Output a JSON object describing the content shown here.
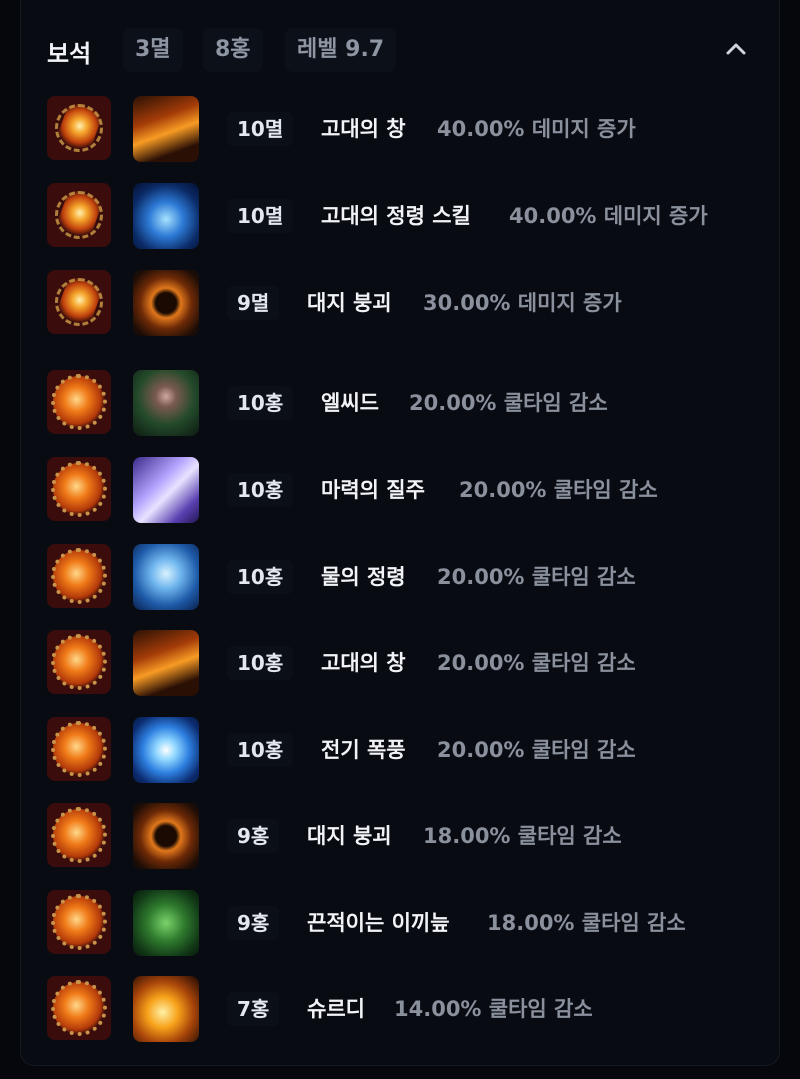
{
  "header": {
    "title": "보석",
    "chips": [
      "3멸",
      "8홍",
      "레벨 9.7"
    ]
  },
  "gems": [
    {
      "gem_type": "ruby",
      "skill_icon": "ancient-spear-icon",
      "level": "10멸",
      "name": "고대의 창",
      "effect": "40.00% 데미지 증가"
    },
    {
      "gem_type": "ruby",
      "skill_icon": "ancient-spirit-skill-icon",
      "level": "10멸",
      "name": "고대의 정령 스킬",
      "effect": "40.00% 데미지 증가"
    },
    {
      "gem_type": "ruby",
      "skill_icon": "earth-collapse-icon",
      "level": "9멸",
      "name": "대지 붕괴",
      "effect": "30.00% 데미지 증가"
    },
    {
      "gem_type": "sapphire",
      "skill_icon": "elcid-icon",
      "level": "10홍",
      "name": "엘씨드",
      "effect": "20.00% 쿨타임 감소"
    },
    {
      "gem_type": "sapphire",
      "skill_icon": "mana-rush-icon",
      "level": "10홍",
      "name": "마력의 질주",
      "effect": "20.00% 쿨타임 감소"
    },
    {
      "gem_type": "sapphire",
      "skill_icon": "water-spirit-icon",
      "level": "10홍",
      "name": "물의 정령",
      "effect": "20.00% 쿨타임 감소"
    },
    {
      "gem_type": "sapphire",
      "skill_icon": "ancient-spear-icon",
      "level": "10홍",
      "name": "고대의 창",
      "effect": "20.00% 쿨타임 감소"
    },
    {
      "gem_type": "sapphire",
      "skill_icon": "electric-storm-icon",
      "level": "10홍",
      "name": "전기 폭풍",
      "effect": "20.00% 쿨타임 감소"
    },
    {
      "gem_type": "sapphire",
      "skill_icon": "earth-collapse-icon",
      "level": "9홍",
      "name": "대지 붕괴",
      "effect": "18.00% 쿨타임 감소"
    },
    {
      "gem_type": "sapphire",
      "skill_icon": "sticky-moss-swamp-icon",
      "level": "9홍",
      "name": "끈적이는 이끼늪",
      "effect": "18.00% 쿨타임 감소"
    },
    {
      "gem_type": "sapphire",
      "skill_icon": "shurdi-icon",
      "level": "7홍",
      "name": "슈르디",
      "effect": "14.00% 쿨타임 감소"
    }
  ]
}
